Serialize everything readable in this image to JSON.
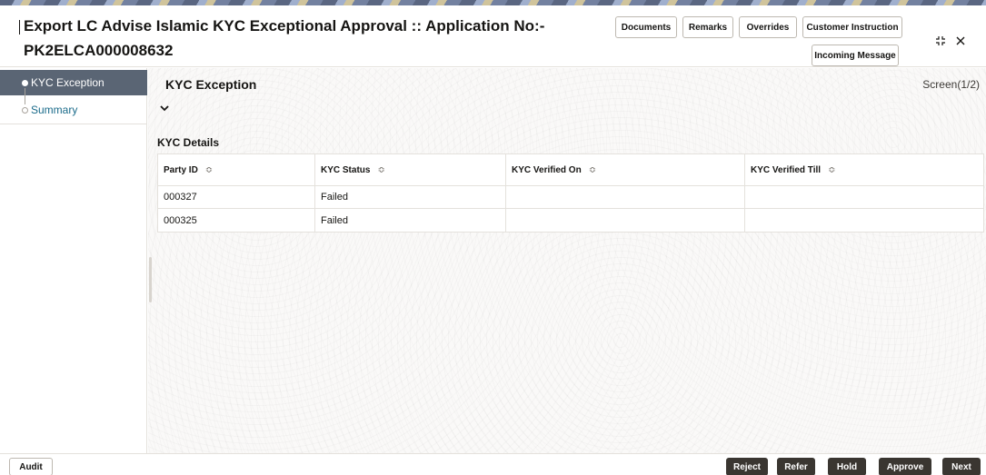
{
  "header": {
    "title_line1": "Export LC Advise Islamic KYC Exceptional Approval :: Application No:-",
    "title_line2": "PK2ELCA000008632",
    "buttons": {
      "documents": "Documents",
      "remarks": "Remarks",
      "overrides": "Overrides",
      "customer_instruction": "Customer Instruction",
      "incoming_message": "Incoming Message"
    },
    "icons": [
      "minimize-icon",
      "close-icon"
    ]
  },
  "sidebar": {
    "items": [
      {
        "label": "KYC Exception",
        "active": true
      },
      {
        "label": "Summary",
        "active": false
      }
    ]
  },
  "main": {
    "section_title": "KYC Exception",
    "screen_indicator": "Screen(1/2)",
    "kyc_details_title": "KYC Details",
    "table": {
      "columns": [
        "Party ID",
        "KYC Status",
        "KYC Verified On",
        "KYC Verified Till"
      ],
      "rows": [
        [
          "000327",
          "Failed",
          "",
          ""
        ],
        [
          "000325",
          "Failed",
          "",
          ""
        ]
      ]
    }
  },
  "footer": {
    "audit": "Audit",
    "reject": "Reject",
    "refer": "Refer",
    "hold": "Hold",
    "approve": "Approve",
    "next": "Next"
  },
  "colors": {
    "sidebar_active_bg": "#5a6574",
    "link_text": "#1a6b8a",
    "dark_button": "#3a3631"
  }
}
